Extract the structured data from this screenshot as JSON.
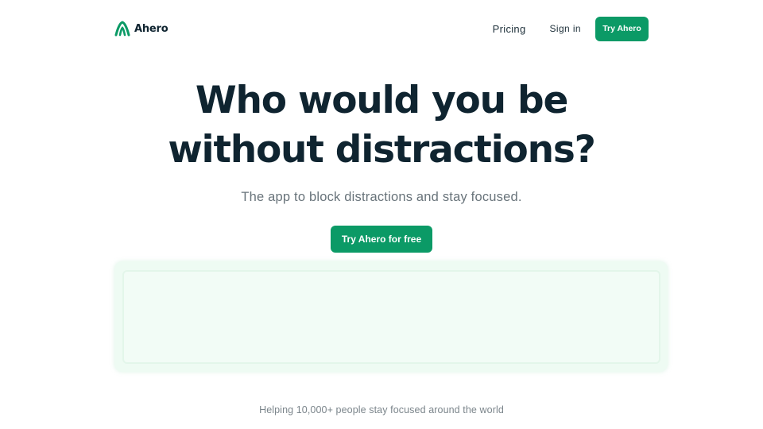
{
  "brand": {
    "name": "Ahero",
    "logo_icon": "ahero-logo-icon"
  },
  "nav": {
    "pricing_label": "Pricing",
    "signin_label": "Sign in",
    "cta_label": "Try Ahero"
  },
  "hero": {
    "title_line1": "Who would you be",
    "title_line2": "without distractions?",
    "subtitle": "The app to block distractions and stay focused.",
    "cta_label": "Try Ahero for free"
  },
  "social_proof": {
    "text": "Helping 10,000+ people stay focused around the world"
  },
  "colors": {
    "accent": "#0b9a66",
    "heading": "#0f2430",
    "muted_text": "#68737a",
    "preview_bg": "#eefbf3"
  }
}
